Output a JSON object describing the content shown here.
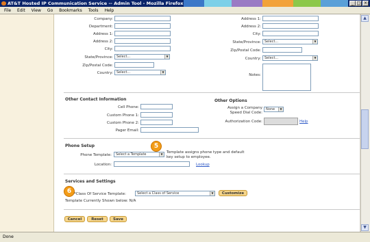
{
  "window": {
    "title": "AT&T Hosted IP Communication Service -- Admin Tool - Mozilla Firefox",
    "min": "_",
    "max": "□",
    "close": "×"
  },
  "menu": [
    "File",
    "Edit",
    "View",
    "Go",
    "Bookmarks",
    "Tools",
    "Help"
  ],
  "form_left": {
    "company": "Company:",
    "department": "Department:",
    "address1": "Address 1:",
    "address2": "Address 2:",
    "city": "City:",
    "state": "State/Province:",
    "state_value": "Select...",
    "zip": "Zip/Postal Code:",
    "country": "Country:",
    "country_value": "Select..."
  },
  "form_right": {
    "address1": "Address 1:",
    "address2": "Address 2:",
    "city": "City:",
    "state": "State/Province:",
    "state_value": "Select...",
    "zip": "Zip/Postal Code:",
    "country": "Country:",
    "country_value": "Select...",
    "notes": "Notes:"
  },
  "other_contact": {
    "title": "Other Contact Information",
    "cell": "Cell Phone:",
    "custom1": "Custom Phone 1:",
    "custom2": "Custom Phone 2:",
    "pager": "Pager Email:"
  },
  "other_options": {
    "title": "Other Options",
    "speed_dial_1": "Assign a Company",
    "speed_dial_2": "Speed Dial Code:",
    "speed_dial_value": "None",
    "auth": "Authorization Code:",
    "help": "Help"
  },
  "phone_setup": {
    "title": "Phone Setup",
    "template_label": "Phone Template:",
    "template_value": "Select a Template",
    "note_1": "Template assigns phone type and default",
    "note_2": "key setup to employee.",
    "location": "Location:",
    "lookup": "Lookup"
  },
  "services": {
    "title": "Services and Settings",
    "cos_label": "*Class Of Service Template:",
    "cos_value": "Select a Class of Service",
    "customize": "Customize",
    "current": "Template Currently Shown below: N/A"
  },
  "markers": {
    "m5": "5",
    "m6": "6"
  },
  "buttons": {
    "cancel": "Cancel",
    "reset": "Reset",
    "save": "Save"
  },
  "status": "Done",
  "colors": {
    "accent": "#f39c18",
    "button": "#f6d58a",
    "link": "#2a56c6",
    "titlebar": "#0a246a"
  }
}
